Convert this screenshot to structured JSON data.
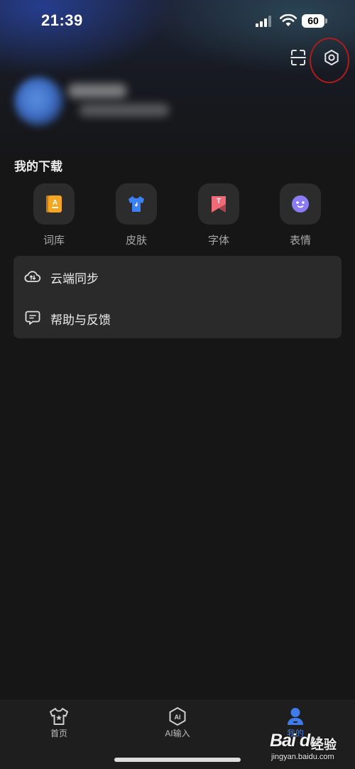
{
  "status_bar": {
    "time": "21:39",
    "battery": "60"
  },
  "header": {
    "scan_icon": "scan-icon",
    "settings_icon": "settings-hexagon-icon"
  },
  "downloads": {
    "title": "我的下载",
    "items": [
      {
        "label": "词库",
        "icon": "lexicon-icon",
        "color": "#f5a623"
      },
      {
        "label": "皮肤",
        "icon": "skin-tshirt-icon",
        "color": "#3b82f6"
      },
      {
        "label": "字体",
        "icon": "font-icon",
        "color": "#f06a78"
      },
      {
        "label": "表情",
        "icon": "emoji-icon",
        "color": "#8b7cf6"
      }
    ]
  },
  "menu": [
    {
      "label": "云端同步",
      "icon": "cloud-sync-icon"
    },
    {
      "label": "帮助与反馈",
      "icon": "feedback-icon"
    }
  ],
  "tab_bar": {
    "tabs": [
      {
        "label": "首页",
        "icon": "home-tshirt-icon",
        "active": false
      },
      {
        "label": "AI输入",
        "icon": "ai-input-icon",
        "active": false
      },
      {
        "label": "我的",
        "icon": "profile-icon",
        "active": true
      }
    ],
    "active_color": "#3f7bea"
  },
  "watermark": {
    "logo": "Bai du",
    "text": "经验",
    "url": "jingyan.baidu.com"
  }
}
